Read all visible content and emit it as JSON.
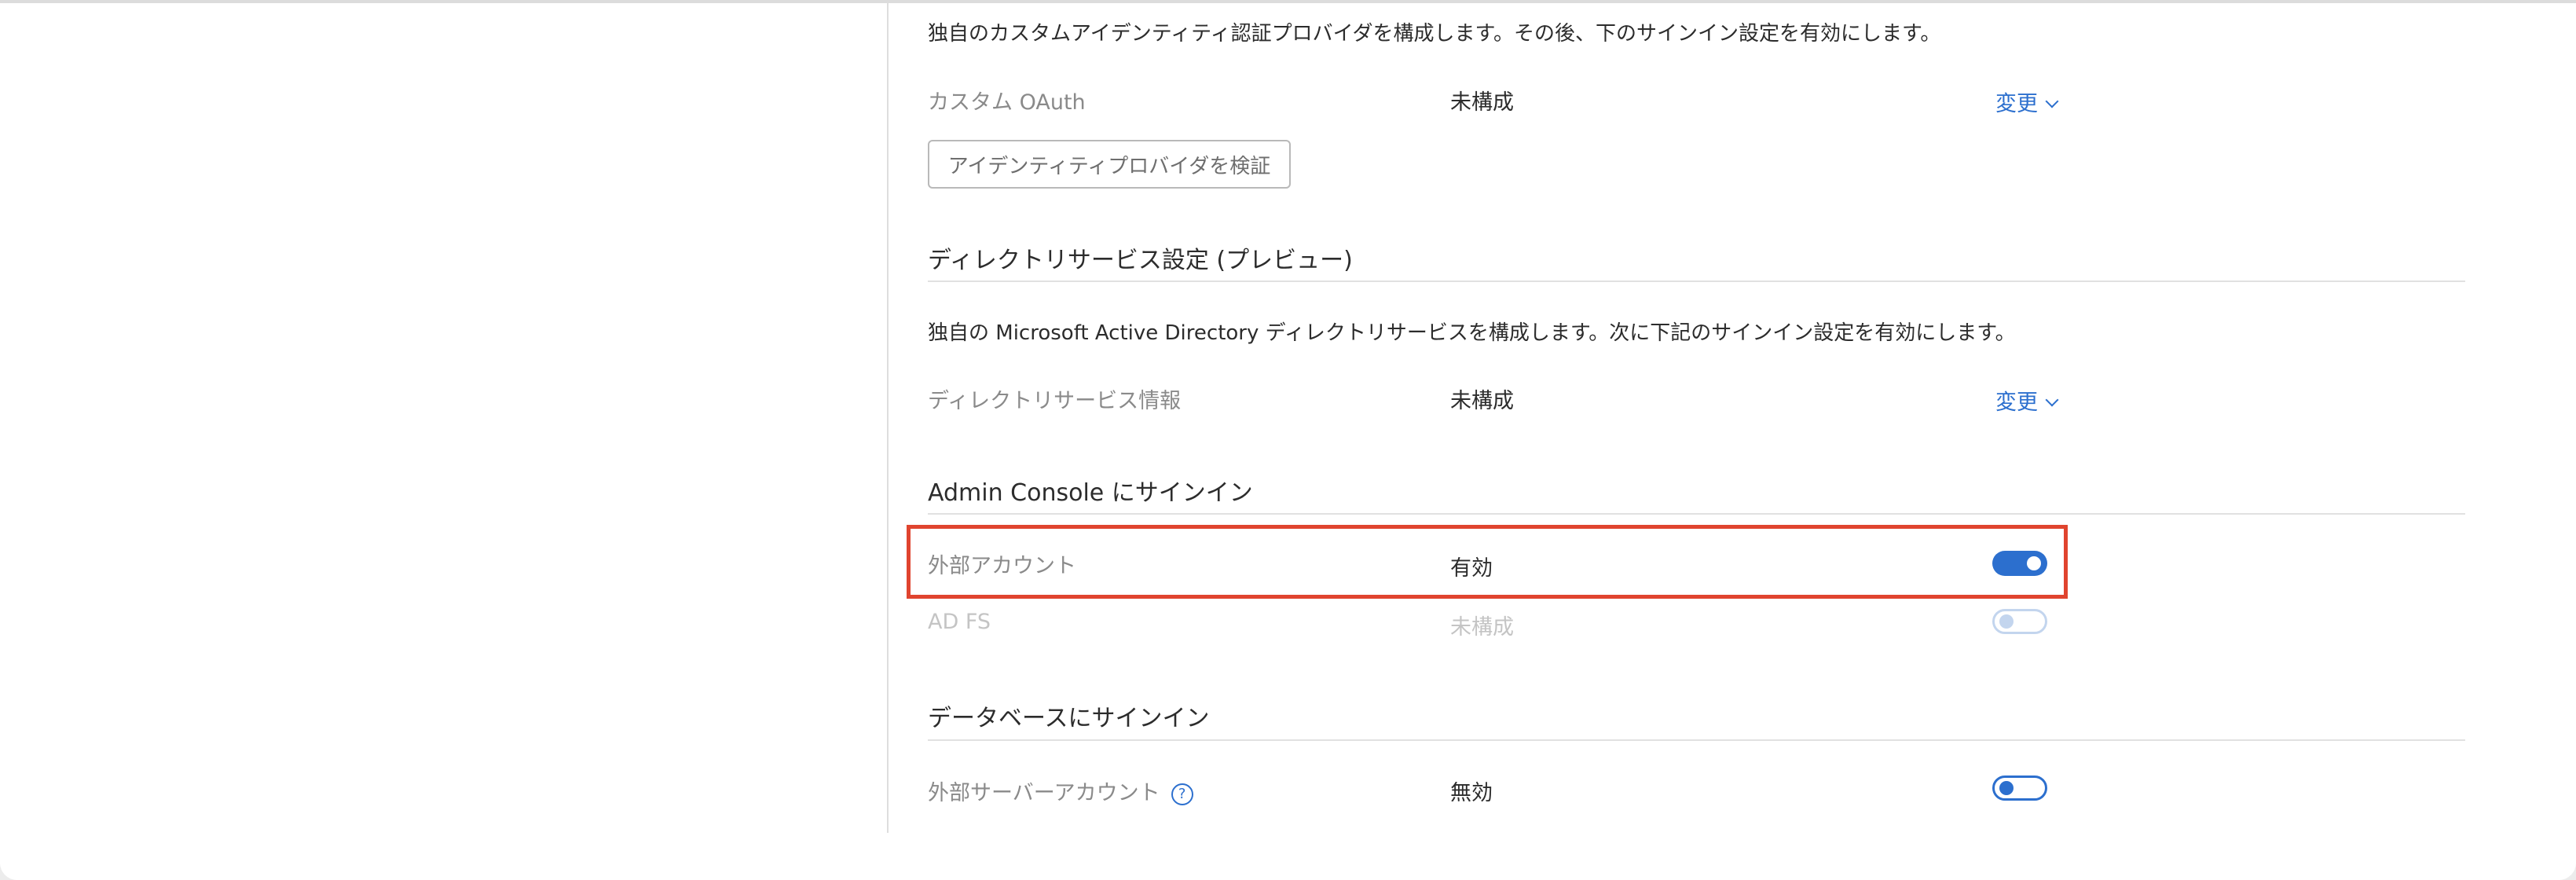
{
  "custom_oauth": {
    "description": "独自のカスタムアイデンティティ認証プロバイダを構成します。その後、下のサインイン設定を有効にします。",
    "label": "カスタム OAuth",
    "value": "未構成",
    "change_label": "変更",
    "verify_button": "アイデンティティプロバイダを検証"
  },
  "directory_service": {
    "title": "ディレクトリサービス設定 (プレビュー)",
    "description": "独自の Microsoft Active Directory ディレクトリサービスを構成します。次に下記のサインイン設定を有効にします。",
    "label": "ディレクトリサービス情報",
    "value": "未構成",
    "change_label": "変更"
  },
  "admin_console_signin": {
    "title": "Admin Console にサインイン",
    "external_account": {
      "label": "外部アカウント",
      "value": "有効",
      "toggle_on": true
    },
    "ad_fs": {
      "label": "AD FS",
      "value": "未構成",
      "toggle_on": false,
      "disabled": true
    }
  },
  "database_signin": {
    "title": "データベースにサインイン",
    "external_server_account": {
      "label": "外部サーバーアカウント",
      "help_icon": "?",
      "value": "無効",
      "toggle_on": false
    }
  },
  "colors": {
    "accent": "#2c6fce",
    "highlight": "#e0442f"
  }
}
